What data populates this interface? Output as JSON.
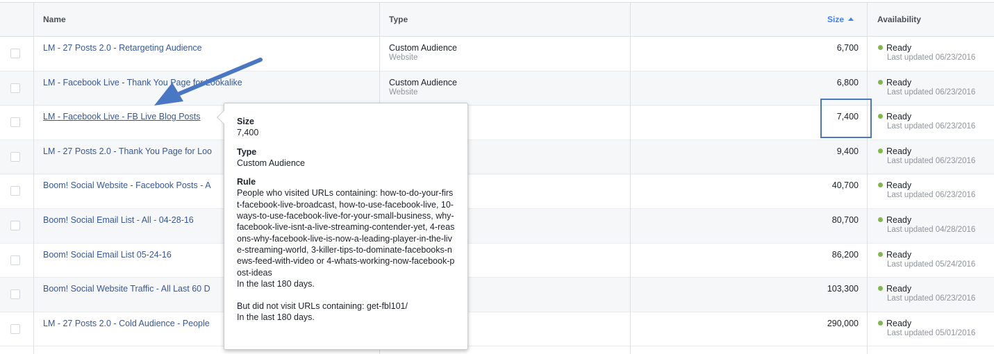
{
  "header": {
    "name": "Name",
    "type": "Type",
    "size": "Size",
    "availability": "Availability"
  },
  "rows": [
    {
      "name": "LM - 27 Posts 2.0 - Retargeting Audience",
      "type": "Custom Audience",
      "subtype": "Website",
      "size": "6,700",
      "status": "Ready",
      "updated": "Last updated 06/23/2016"
    },
    {
      "name": "LM - Facebook Live - Thank You Page for Lookalike",
      "type": "Custom Audience",
      "subtype": "Website",
      "size": "6,800",
      "status": "Ready",
      "updated": "Last updated 06/23/2016"
    },
    {
      "name": "LM - Facebook Live - FB Live Blog Posts",
      "type": "",
      "subtype": "",
      "size": "7,400",
      "status": "Ready",
      "updated": "Last updated 06/23/2016"
    },
    {
      "name": "LM - 27 Posts 2.0 - Thank You Page for Loo",
      "type": "",
      "subtype": "",
      "size": "9,400",
      "status": "Ready",
      "updated": "Last updated 06/23/2016"
    },
    {
      "name": "Boom! Social Website - Facebook Posts - A",
      "type": "",
      "subtype": "",
      "size": "40,700",
      "status": "Ready",
      "updated": "Last updated 06/23/2016"
    },
    {
      "name": "Boom! Social Email List - All - 04-28-16",
      "type": "",
      "subtype": "",
      "size": "80,700",
      "status": "Ready",
      "updated": "Last updated 04/28/2016"
    },
    {
      "name": "Boom! Social Email List 05-24-16",
      "type": "",
      "subtype": "",
      "size": "86,200",
      "status": "Ready",
      "updated": "Last updated 05/24/2016"
    },
    {
      "name": "Boom! Social Website Traffic - All Last 60 D",
      "type": "",
      "subtype": "",
      "size": "103,300",
      "status": "Ready",
      "updated": "Last updated 06/23/2016"
    },
    {
      "name": "LM - 27 Posts 2.0 - Cold Audience - People",
      "type": "",
      "subtype": "",
      "size": "290,000",
      "status": "Ready",
      "updated": "Last updated 05/01/2016"
    }
  ],
  "tooltip": {
    "size_label": "Size",
    "size_value": "7,400",
    "type_label": "Type",
    "type_value": "Custom Audience",
    "rule_label": "Rule",
    "rule_text": "People who visited URLs containing: how-to-do-your-first-facebook-live-broadcast, how-to-use-facebook-live, 10-ways-to-use-facebook-live-for-your-small-business, why-facebook-live-isnt-a-live-streaming-contender-yet, 4-reasons-why-facebook-live-is-now-a-leading-player-in-the-live-streaming-world, 3-killer-tips-to-dominate-facebooks-news-feed-with-video or 4-whats-working-now-facebook-post-ideas",
    "rule_period": "In the last 180 days.",
    "exclude_text": "But did not visit URLs containing: get-fbl101/",
    "exclude_period": "In the last 180 days."
  },
  "colors": {
    "link": "#365899",
    "ready_dot": "#7fb84a",
    "annotation": "#4a77c4",
    "sort_accent": "#4080ff"
  },
  "icons": {
    "sort": "caret-up-icon",
    "status": "green-dot-icon",
    "annotation_arrow": "arrow-icon"
  }
}
